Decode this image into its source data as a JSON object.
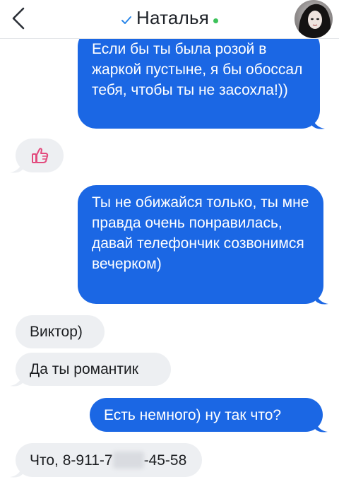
{
  "header": {
    "title": "Наталья",
    "verified_icon": "check-icon",
    "online_color": "#3cc25a"
  },
  "colors": {
    "outgoing_bubble": "#1b67e4",
    "incoming_bubble": "#edeff2",
    "outgoing_text": "#ffffff",
    "incoming_text": "#1c1e21"
  },
  "messages": [
    {
      "direction": "out",
      "text": "Если бы ты была розой в жаркой пустыне, я бы обоссал тебя, чтобы ты не засохла!))"
    },
    {
      "direction": "in",
      "content": "thumbs-up-sticker"
    },
    {
      "direction": "out",
      "text": "Ты не обижайся только, ты мне правда очень понравилась, давай телефончик созвонимся вечерком)"
    },
    {
      "direction": "in",
      "text": "Виктор)"
    },
    {
      "direction": "in",
      "text": "Да ты романтик"
    },
    {
      "direction": "out",
      "text": "Есть немного) ну так что?"
    },
    {
      "direction": "in",
      "text_before": "Что, 8-911-7",
      "text_after": "-45-58"
    }
  ]
}
